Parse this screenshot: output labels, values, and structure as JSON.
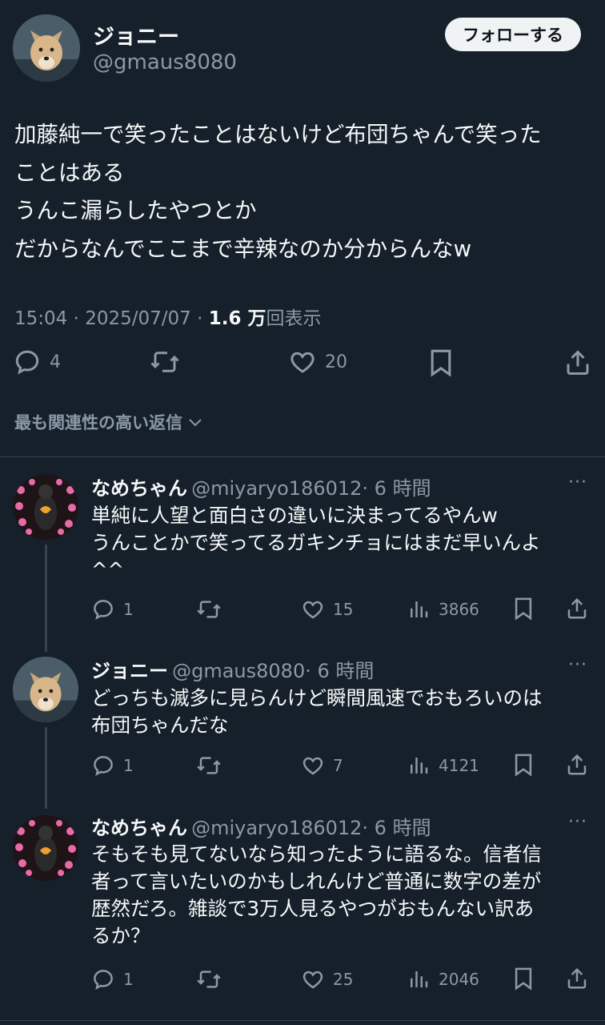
{
  "main_tweet": {
    "author_name": "ジョニー",
    "author_handle": "@gmaus8080",
    "follow_label": "フォローする",
    "lines": [
      "加藤純一で笑ったことはないけど布団ちゃんで笑った",
      "ことはある",
      "うんこ漏らしたやつとか",
      "だからなんでここまで辛辣なのか分からんなw"
    ],
    "time": "15:04 · 2025/07/07 · ",
    "views": "1.6 万",
    "views_suffix": "回表示",
    "reply_count": "4",
    "like_count": "20"
  },
  "sort_label": "最も関連性の高い返信",
  "replies": [
    {
      "name": "なめちゃん",
      "handle": "@miyaryo186012",
      "time": "· 6 時間",
      "lines": [
        "単純に人望と面白さの違いに決まってるやんw",
        "うんことかで笑ってるガキンチョにはまだ早いんよ",
        "^^"
      ],
      "reply_count": "1",
      "like_count": "15",
      "view_count": "3866"
    },
    {
      "name": "ジョニー",
      "handle": "@gmaus8080",
      "time": "· 6 時間",
      "lines": [
        "どっちも滅多に見らんけど瞬間風速でおもろいのは",
        "布団ちゃんだな"
      ],
      "reply_count": "1",
      "like_count": "7",
      "view_count": "4121"
    },
    {
      "name": "なめちゃん",
      "handle": "@miyaryo186012",
      "time": "· 6 時間",
      "lines": [
        "そもそも見てないなら知ったように語るな。信者信",
        "者って言いたいのかもしれんけど普通に数字の差が",
        "歴然だろ。雑談で3万人見るやつがおもんない訳あ",
        "るか？"
      ],
      "reply_count": "1",
      "like_count": "25",
      "view_count": "2046"
    }
  ],
  "more_label": "···",
  "icons": {
    "reply": "reply-icon",
    "retweet": "retweet-icon",
    "like": "heart-icon",
    "bookmark": "bookmark-icon",
    "share": "share-icon",
    "views": "views-icon",
    "chevron": "chevron-down-icon"
  }
}
